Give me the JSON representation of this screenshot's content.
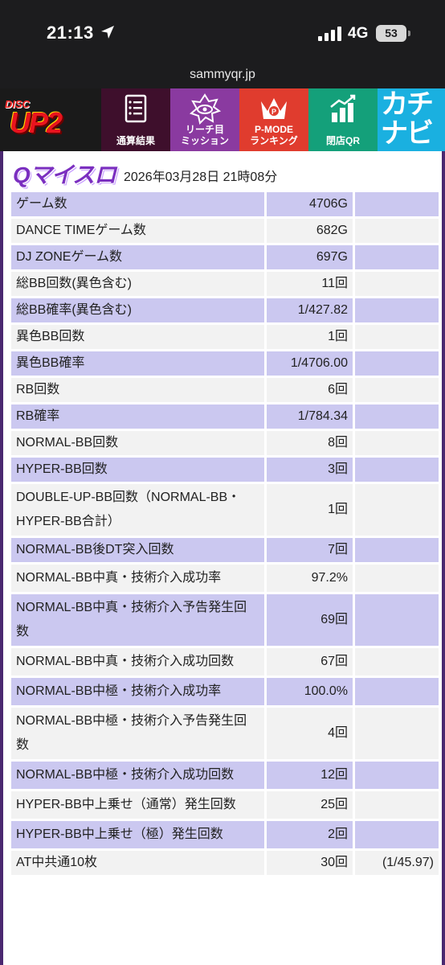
{
  "status_bar": {
    "time": "21:13",
    "network": "4G",
    "battery": "53",
    "url": "sammyqr.jp"
  },
  "nav": {
    "logo": {
      "small": "DISC",
      "main": "UP2"
    },
    "items": [
      {
        "label_line1": "通算結果",
        "label_line2": "",
        "icon": "list-document-icon"
      },
      {
        "label_line1": "リーチ目",
        "label_line2": "ミッション",
        "icon": "eye-emblem-icon"
      },
      {
        "label_line1": "P-MODE",
        "label_line2": "ランキング",
        "icon": "crown-icon"
      },
      {
        "label_line1": "閉店QR",
        "label_line2": "",
        "icon": "bar-chart-icon"
      }
    ],
    "kachi": {
      "text_line1": "カチ",
      "text_line2": "ナビ"
    }
  },
  "header": {
    "logo_text": "Qマイスロ",
    "datetime": "2026年03月28日 21時08分"
  },
  "colors": {
    "row_purple": "#cbc8f0",
    "row_gray": "#f2f2f2",
    "frame": "#4a2870"
  },
  "rows": [
    {
      "label": "ゲーム数",
      "value": "4706G",
      "extra": "",
      "style": "purple"
    },
    {
      "label": "DANCE TIMEゲーム数",
      "value": "682G",
      "extra": "",
      "style": "gray"
    },
    {
      "label": "DJ ZONEゲーム数",
      "value": "697G",
      "extra": "",
      "style": "purple"
    },
    {
      "label": "総BB回数(異色含む)",
      "value": "11回",
      "extra": "",
      "style": "gray"
    },
    {
      "label": "総BB確率(異色含む)",
      "value": "1/427.82",
      "extra": "",
      "style": "purple"
    },
    {
      "label": "異色BB回数",
      "value": "1回",
      "extra": "",
      "style": "gray"
    },
    {
      "label": "異色BB確率",
      "value": "1/4706.00",
      "extra": "",
      "style": "purple"
    },
    {
      "label": "RB回数",
      "value": "6回",
      "extra": "",
      "style": "gray"
    },
    {
      "label": "RB確率",
      "value": "1/784.34",
      "extra": "",
      "style": "purple"
    },
    {
      "label": "NORMAL-BB回数",
      "value": "8回",
      "extra": "",
      "style": "gray"
    },
    {
      "label": "HYPER-BB回数",
      "value": "3回",
      "extra": "",
      "style": "purple"
    },
    {
      "label": "DOUBLE-UP-BB回数（NORMAL-BB・HYPER-BB合計）",
      "value": "1回",
      "extra": "",
      "style": "gray"
    },
    {
      "label": "NORMAL-BB後DT突入回数",
      "value": "7回",
      "extra": "",
      "style": "purple"
    },
    {
      "label": "NORMAL-BB中真・技術介入成功率",
      "value": "97.2%",
      "extra": "",
      "style": "gray"
    },
    {
      "label": "NORMAL-BB中真・技術介入予告発生回数",
      "value": "69回",
      "extra": "",
      "style": "purple"
    },
    {
      "label": "NORMAL-BB中真・技術介入成功回数",
      "value": "67回",
      "extra": "",
      "style": "gray"
    },
    {
      "label": "NORMAL-BB中極・技術介入成功率",
      "value": "100.0%",
      "extra": "",
      "style": "purple"
    },
    {
      "label": "NORMAL-BB中極・技術介入予告発生回数",
      "value": "4回",
      "extra": "",
      "style": "gray"
    },
    {
      "label": "NORMAL-BB中極・技術介入成功回数",
      "value": "12回",
      "extra": "",
      "style": "purple"
    },
    {
      "label": "HYPER-BB中上乗せ（通常）発生回数",
      "value": "25回",
      "extra": "",
      "style": "gray"
    },
    {
      "label": "HYPER-BB中上乗せ（極）発生回数",
      "value": "2回",
      "extra": "",
      "style": "purple"
    },
    {
      "label": "AT中共通10枚",
      "value": "30回",
      "extra": "(1/45.97)",
      "style": "gray"
    }
  ]
}
